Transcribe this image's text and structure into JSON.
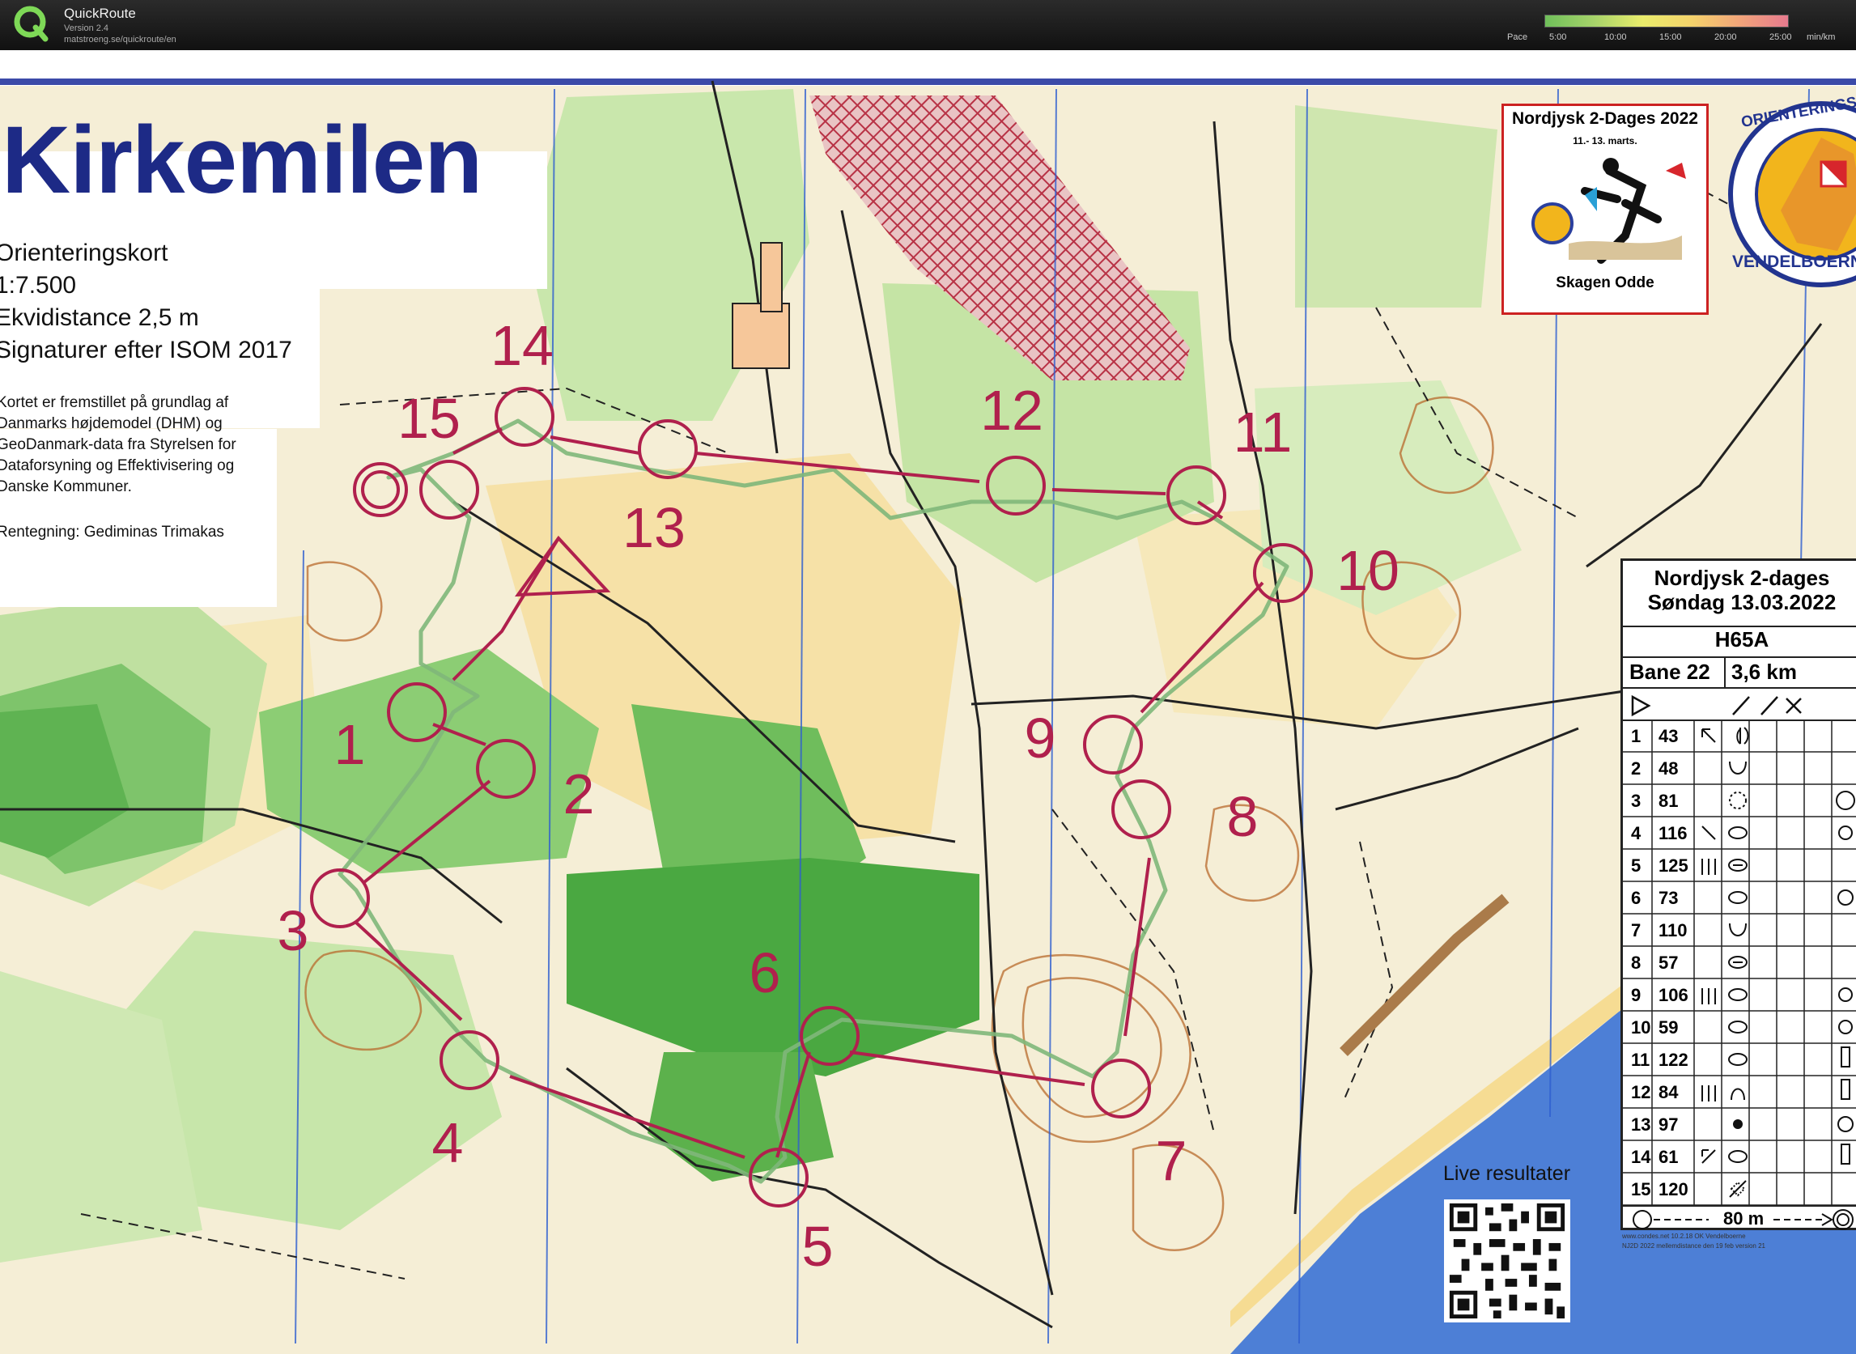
{
  "app": {
    "name": "QuickRoute",
    "version": "Version 2.4",
    "url": "matstroeng.se/quickroute/en"
  },
  "pace_scale": {
    "label": "Pace",
    "ticks": [
      "5:00",
      "10:00",
      "15:00",
      "20:00",
      "25:00"
    ],
    "unit": "min/km",
    "colors": [
      "#6fbf5a",
      "#e9ec6b",
      "#e67a8e"
    ]
  },
  "map": {
    "title": "Kirkemilen",
    "info_lines": [
      "Orienteringskort",
      "1:7.500",
      "Ekvidistance 2,5 m",
      "Signaturer efter ISOM 2017"
    ],
    "source_lines": [
      "Kortet er fremstillet på grundlag af",
      "Danmarks højdemodel (DHM) og",
      "GeoDanmark-data fra Styrelsen for",
      "Dataforsyning og Effektivisering og",
      "Danske Kommuner."
    ],
    "drawing_credit": "Rentegning: Gediminas Trimakas",
    "course_color": "#b0204d",
    "route_color": "#7fb77a"
  },
  "event_box": {
    "title": "Nordjysk 2-Dages 2022",
    "dates": "11.- 13. marts.",
    "place": "Skagen Odde"
  },
  "club_logo": {
    "top_text": "ORIENTERINGSKLUB",
    "bottom_text": "VENDELBOERNE"
  },
  "control_numbers": [
    "1",
    "2",
    "3",
    "4",
    "5",
    "6",
    "7",
    "8",
    "9",
    "10",
    "11",
    "12",
    "13",
    "14",
    "15"
  ],
  "description": {
    "event": "Nordjysk 2-dages",
    "date": "Søndag 13.03.2022",
    "class": "H65A",
    "course": "Bane 22",
    "length": "3,6 km",
    "rows": [
      {
        "n": "1",
        "code": "43"
      },
      {
        "n": "2",
        "code": "48"
      },
      {
        "n": "3",
        "code": "81"
      },
      {
        "n": "4",
        "code": "116"
      },
      {
        "n": "5",
        "code": "125"
      },
      {
        "n": "6",
        "code": "73"
      },
      {
        "n": "7",
        "code": "110"
      },
      {
        "n": "8",
        "code": "57"
      },
      {
        "n": "9",
        "code": "106"
      },
      {
        "n": "10",
        "code": "59"
      },
      {
        "n": "11",
        "code": "122"
      },
      {
        "n": "12",
        "code": "84"
      },
      {
        "n": "13",
        "code": "97"
      },
      {
        "n": "14",
        "code": "61"
      },
      {
        "n": "15",
        "code": "120"
      }
    ],
    "finish_distance": "80 m",
    "footer1": "www.condes.net 10.2.18 OK Vendelboerne",
    "footer2": "NJ2D 2022 mellemdistance den 19 feb version 21"
  },
  "live_results": "Live resultater"
}
